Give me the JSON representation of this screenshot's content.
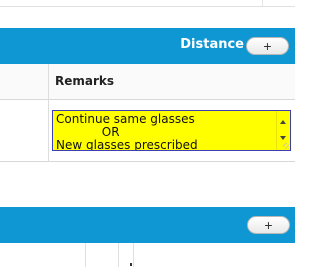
{
  "distance_section": {
    "title": "Distance",
    "add_button": {
      "label": "+",
      "icon": "plus-icon"
    }
  },
  "remarks_table": {
    "column_header": "Remarks",
    "remarks_value": "Continue same glasses\n            OR\nNew glasses prescribed"
  },
  "second_section": {
    "add_button": {
      "label": "+",
      "icon": "plus-icon"
    }
  },
  "colors": {
    "section_bar": "#0e97d3",
    "remarks_background": "#ffff00",
    "remarks_border": "#3d3db4"
  }
}
